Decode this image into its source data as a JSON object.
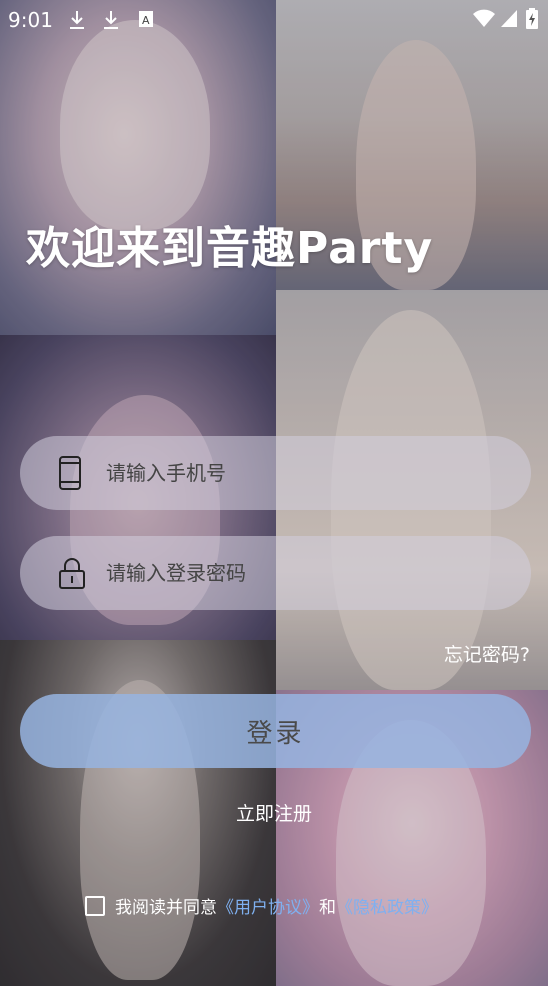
{
  "status_bar": {
    "time": "9:01",
    "icons": [
      "download-icon",
      "download-icon",
      "a-box-icon",
      "wifi-icon",
      "signal-icon",
      "battery-icon"
    ]
  },
  "welcome_title": "欢迎来到音趣Party",
  "form": {
    "phone_placeholder": "请输入手机号",
    "password_placeholder": "请输入登录密码",
    "forgot_password": "忘记密码?",
    "login_button": "登录",
    "register_link": "立即注册"
  },
  "agreement": {
    "prefix": "我阅读并同意",
    "user_agreement": "《用户协议》",
    "and": "和",
    "privacy_policy": "《隐私政策》",
    "checked": false
  },
  "colors": {
    "field_bg": "#d2cddc",
    "login_button": "#96b4e1",
    "link": "#7fb0f0",
    "text": "#ffffff"
  }
}
